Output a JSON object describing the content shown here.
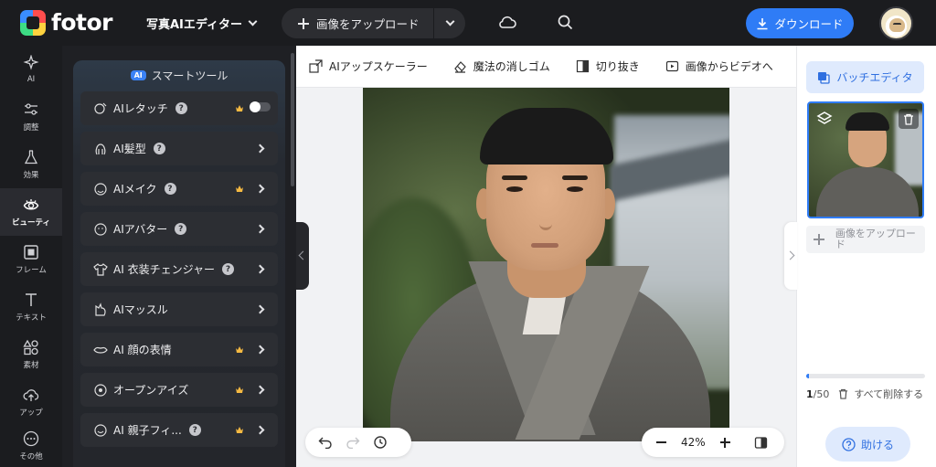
{
  "header": {
    "logo_text": "fotor",
    "editor_title": "写真AIエディター",
    "upload_label": "画像をアップロード",
    "download_label": "ダウンロード"
  },
  "rail": {
    "items": [
      {
        "label": "AI",
        "icon": "sparkle-icon"
      },
      {
        "label": "調整",
        "icon": "sliders-icon"
      },
      {
        "label": "効果",
        "icon": "flask-icon"
      },
      {
        "label": "ビューティ",
        "icon": "eye-icon",
        "active": true
      },
      {
        "label": "フレーム",
        "icon": "frame-icon"
      },
      {
        "label": "テキスト",
        "icon": "text-icon"
      },
      {
        "label": "素材",
        "icon": "shapes-icon"
      },
      {
        "label": "アップ",
        "icon": "cloud-upload-icon"
      },
      {
        "label": "その他",
        "icon": "more-icon"
      }
    ]
  },
  "panel": {
    "badge": "AI",
    "title": "スマートツール",
    "tools": [
      {
        "label": "AIレタッチ",
        "help": true,
        "premium": true,
        "control": "toggle"
      },
      {
        "label": "AI髪型",
        "help": true,
        "premium": false,
        "control": "arrow"
      },
      {
        "label": "AIメイク",
        "help": true,
        "premium": true,
        "control": "arrow"
      },
      {
        "label": "AIアバター",
        "help": true,
        "premium": false,
        "control": "arrow"
      },
      {
        "label": "AI 衣装チェンジャー",
        "help": true,
        "premium": false,
        "control": "arrow"
      },
      {
        "label": "AIマッスル",
        "help": false,
        "premium": false,
        "control": "arrow"
      },
      {
        "label": "AI 顔の表情",
        "help": false,
        "premium": true,
        "control": "arrow"
      },
      {
        "label": "オープンアイズ",
        "help": false,
        "premium": true,
        "control": "arrow"
      },
      {
        "label": "AI 親子フィ...",
        "help": true,
        "premium": true,
        "control": "arrow"
      }
    ]
  },
  "toolbar": {
    "upscaler": "AIアップスケーラー",
    "magic_eraser": "魔法の消しゴム",
    "cutout": "切り抜き",
    "image_to_video": "画像からビデオへ"
  },
  "zoom": {
    "level": "42%"
  },
  "right": {
    "batch_label": "バッチエディタ",
    "upload_label": "画像をアップロード",
    "count_current": "1",
    "count_total": "/50",
    "progress": 0.02,
    "delete_all": "すべて削除する",
    "help_label": "助ける"
  },
  "colors": {
    "accent": "#2f7cf6",
    "premium": "#f5b942",
    "dark_bg": "#1b1c1f"
  }
}
